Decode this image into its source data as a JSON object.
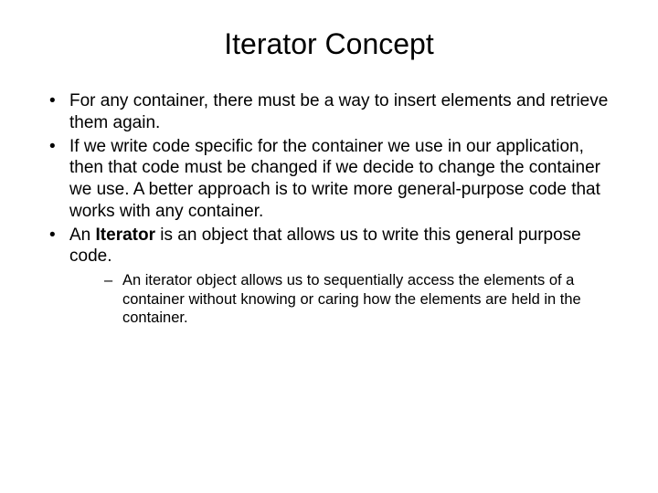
{
  "title": "Iterator Concept",
  "bullets": {
    "b1": "For any container, there must be a way to insert elements and retrieve them again.",
    "b2": "If we write code specific for the container we use in our application, then that code must be changed if we decide to change the container we use. A better approach is to write more general-purpose code that works with any container.",
    "b3_prefix": "An ",
    "b3_bold": "Iterator",
    "b3_suffix": " is an object that allows us to write this general purpose code.",
    "sub1": "An iterator object allows us to sequentially access the elements of a container without knowing or caring how the elements are held in the container."
  }
}
